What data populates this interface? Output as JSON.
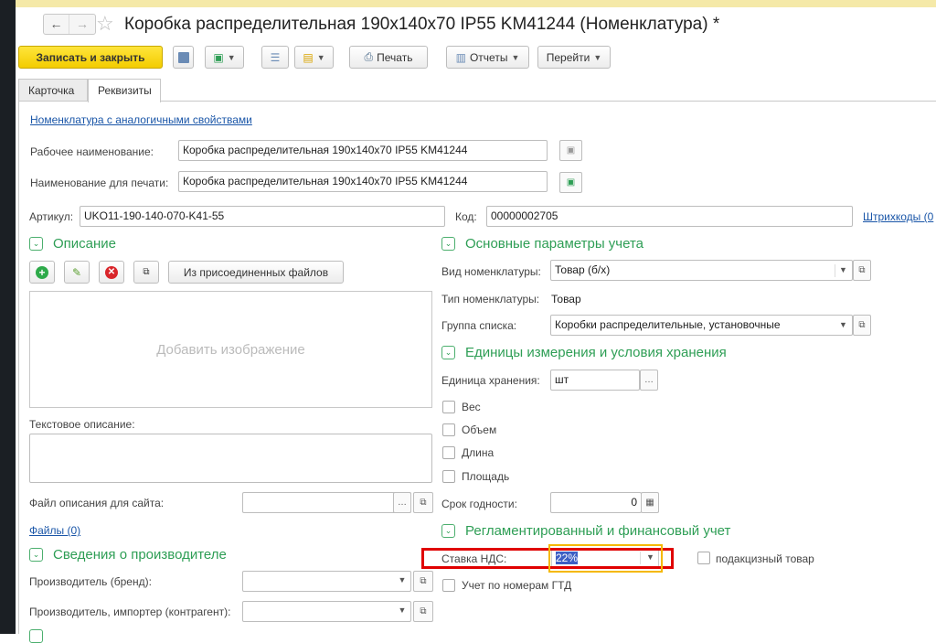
{
  "window": {
    "title": "Коробка распределительная 190x140x70 IP55 KM41244 (Номенклатура) *"
  },
  "nav": {
    "back": "←",
    "forward": "→",
    "star": "☆"
  },
  "toolbar": {
    "save_close": "Записать и закрыть",
    "print": "Печать",
    "reports": "Отчеты",
    "goto": "Перейти"
  },
  "tabs": [
    {
      "label": "Карточка"
    },
    {
      "label": "Реквизиты"
    }
  ],
  "form": {
    "analog_link": "Номенклатура с аналогичными свойствами",
    "work_name_label": "Рабочее наименование:",
    "work_name": "Коробка распределительная 190x140x70 IP55 KM41244",
    "print_name_label": "Наименование для печати:",
    "print_name": "Коробка распределительная 190x140x70 IP55 KM41244",
    "article_label": "Артикул:",
    "article": "UKO11-190-140-070-K41-55",
    "code_label": "Код:",
    "code": "00000002705",
    "barcodes_link": "Штрихкоды (0",
    "description_title": "Описание",
    "from_files": "Из присоединенных файлов",
    "add_image": "Добавить изображение",
    "text_desc_label": "Текстовое описание:",
    "site_file_label": "Файл описания для сайта:",
    "files_link": "Файлы (0)",
    "manufacturer_title": "Сведения о производителе",
    "brand_label": "Производитель (бренд):",
    "importer_label": "Производитель, импортер (контрагент):",
    "main_params_title": "Основные параметры учета",
    "kind_label": "Вид номенклатуры:",
    "kind": "Товар (б/х)",
    "type_label": "Тип номенклатуры:",
    "type": "Товар",
    "group_label": "Группа списка:",
    "group": "Коробки распределительные, установочные",
    "units_title": "Единицы измерения и условия хранения",
    "unit_label": "Единица хранения:",
    "unit": "шт",
    "weight": "Вес",
    "volume": "Объем",
    "length": "Длина",
    "area": "Площадь",
    "shelf_life_label": "Срок годности:",
    "shelf_life": "0",
    "reg_title": "Регламентированный и финансовый учет",
    "vat_label": "Ставка НДС:",
    "vat": "22%",
    "excise": "подакцизный товар",
    "gtd": "Учет по номерам ГТД"
  },
  "colors": {
    "accent_green": "#2e9e55",
    "primary_yellow": "#f3cc00",
    "highlight_red": "#e00000",
    "highlight_orange": "#f5b800"
  }
}
